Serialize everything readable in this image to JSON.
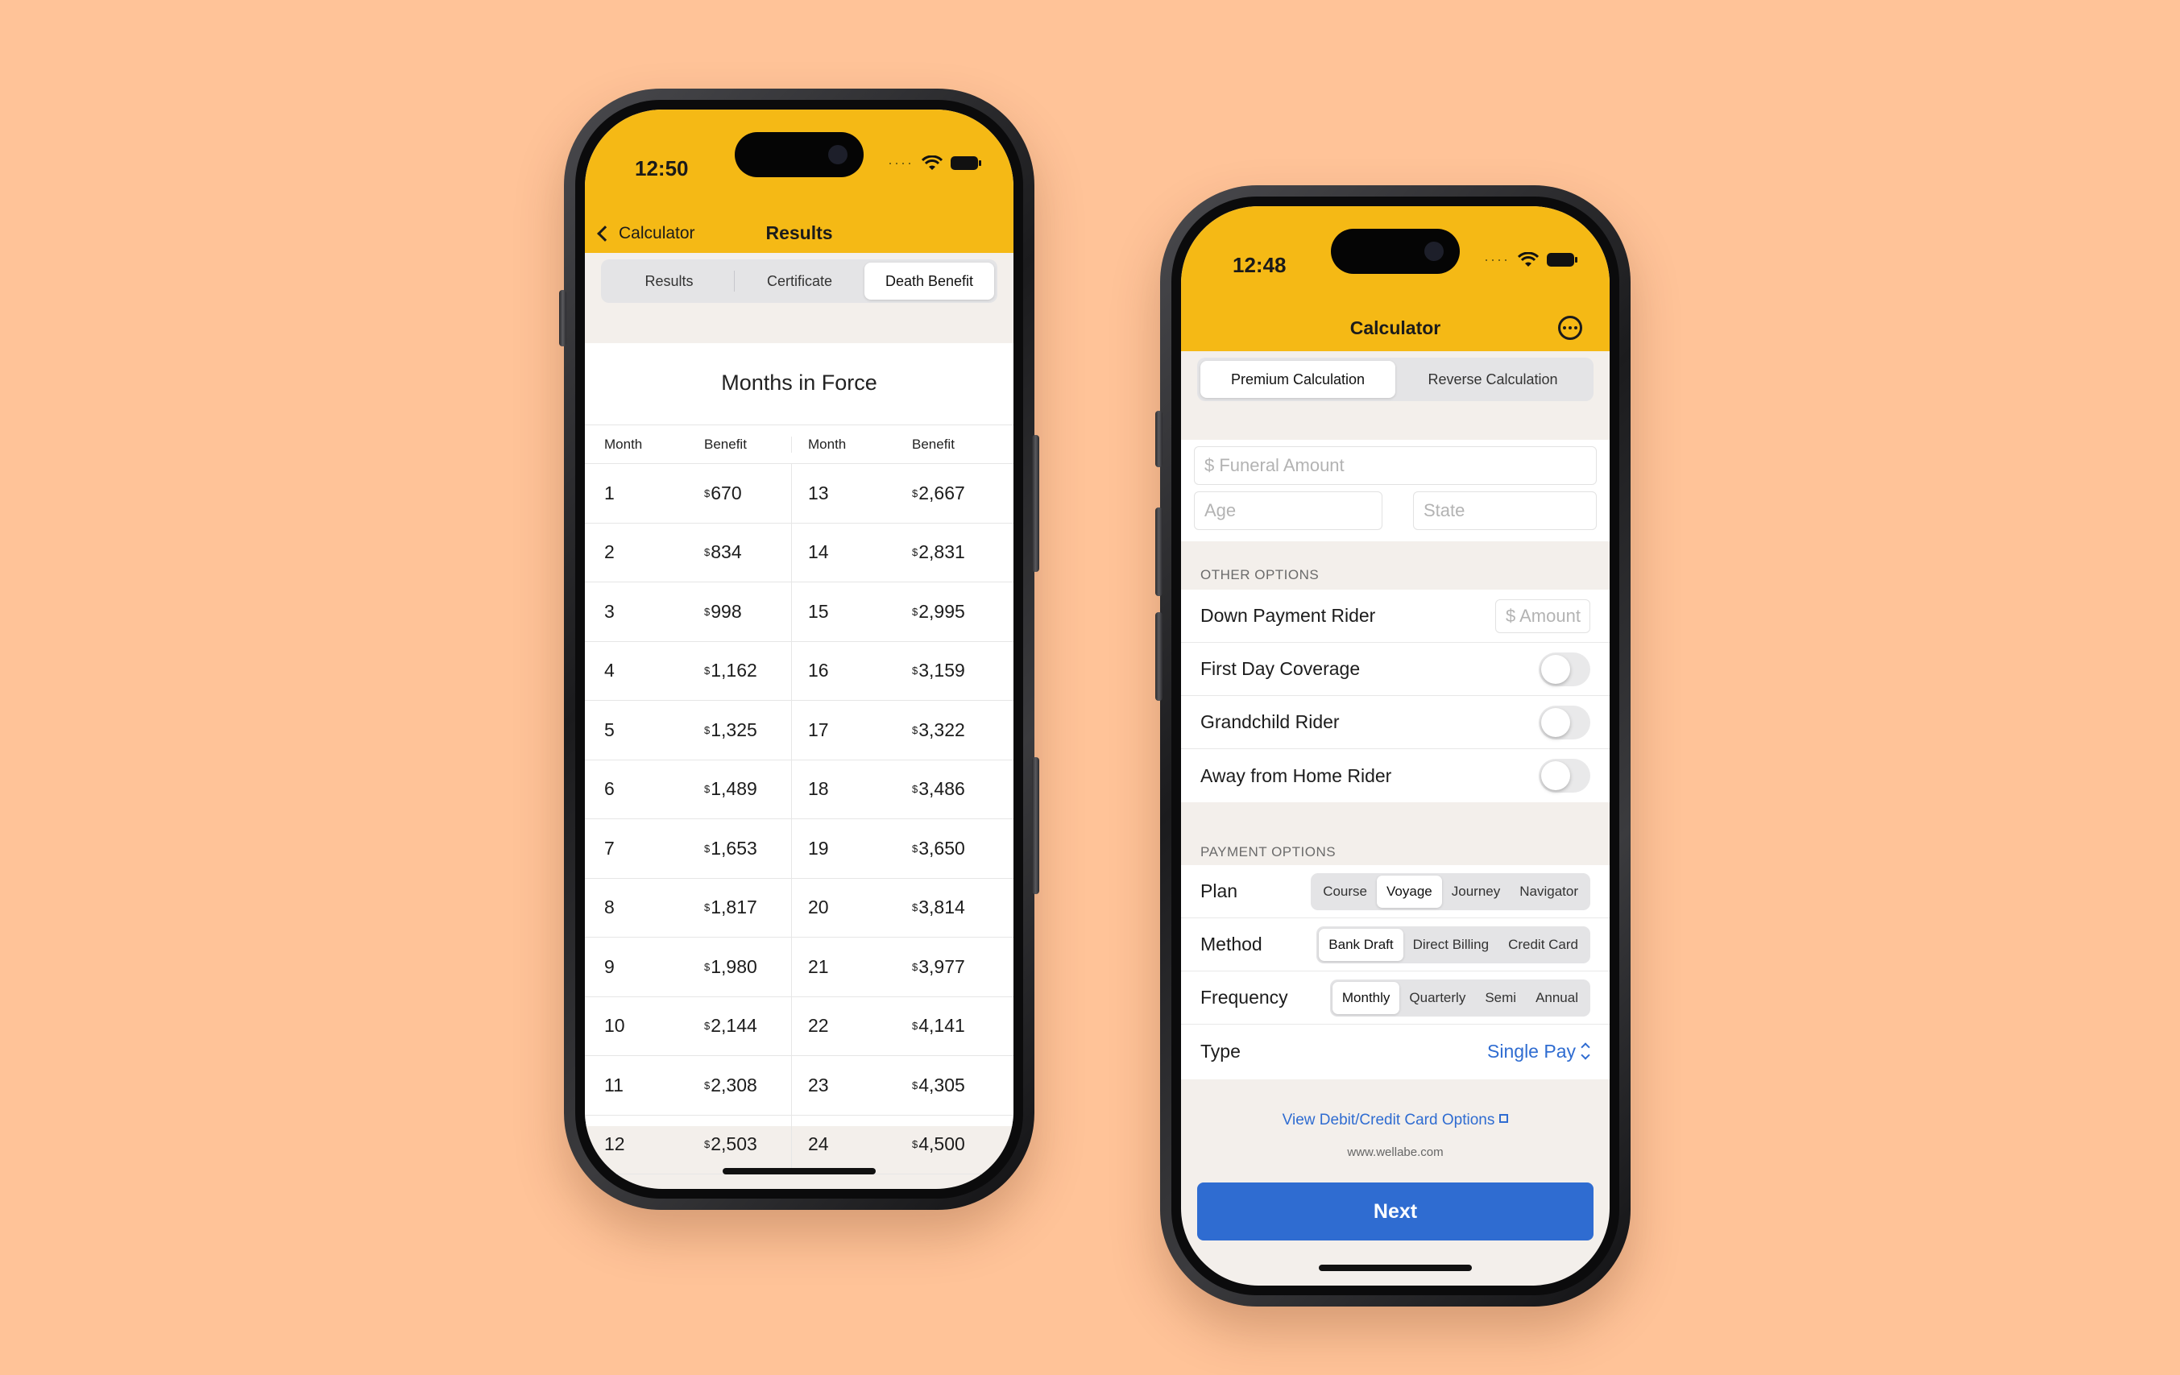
{
  "colors": {
    "background": "#ffc398",
    "header": "#f5b915",
    "accent": "#2f6cd1"
  },
  "phone1": {
    "time": "12:50",
    "back_label": "Calculator",
    "title": "Results",
    "tabs": [
      "Results",
      "Certificate",
      "Death Benefit"
    ],
    "active_tab": "Death Benefit",
    "table_title": "Months in Force",
    "headers": [
      "Month",
      "Benefit",
      "Month",
      "Benefit"
    ],
    "currency_symbol": "$",
    "rows": [
      {
        "m1": "1",
        "b1": "670",
        "m2": "13",
        "b2": "2,667"
      },
      {
        "m1": "2",
        "b1": "834",
        "m2": "14",
        "b2": "2,831"
      },
      {
        "m1": "3",
        "b1": "998",
        "m2": "15",
        "b2": "2,995"
      },
      {
        "m1": "4",
        "b1": "1,162",
        "m2": "16",
        "b2": "3,159"
      },
      {
        "m1": "5",
        "b1": "1,325",
        "m2": "17",
        "b2": "3,322"
      },
      {
        "m1": "6",
        "b1": "1,489",
        "m2": "18",
        "b2": "3,486"
      },
      {
        "m1": "7",
        "b1": "1,653",
        "m2": "19",
        "b2": "3,650"
      },
      {
        "m1": "8",
        "b1": "1,817",
        "m2": "20",
        "b2": "3,814"
      },
      {
        "m1": "9",
        "b1": "1,980",
        "m2": "21",
        "b2": "3,977"
      },
      {
        "m1": "10",
        "b1": "2,144",
        "m2": "22",
        "b2": "4,141"
      },
      {
        "m1": "11",
        "b1": "2,308",
        "m2": "23",
        "b2": "4,305"
      },
      {
        "m1": "12",
        "b1": "2,503",
        "m2": "24",
        "b2": "4,500"
      }
    ]
  },
  "phone2": {
    "time": "12:48",
    "title": "Calculator",
    "tabs": [
      "Premium Calculation",
      "Reverse Calculation"
    ],
    "active_tab": "Premium Calculation",
    "funeral_placeholder": "$  Funeral Amount",
    "age_placeholder": "Age",
    "state_placeholder": "State",
    "other_options_label": "OTHER OPTIONS",
    "down_payment_label": "Down Payment Rider",
    "amount_placeholder": "$  Amount",
    "first_day_label": "First Day Coverage",
    "grandchild_label": "Grandchild Rider",
    "away_label": "Away from Home Rider",
    "payment_options_label": "PAYMENT OPTIONS",
    "plan_label": "Plan",
    "plan_options": [
      "Course",
      "Voyage",
      "Journey",
      "Navigator"
    ],
    "plan_selected": "Voyage",
    "method_label": "Method",
    "method_options": [
      "Bank Draft",
      "Direct Billing",
      "Credit Card"
    ],
    "method_selected": "Bank Draft",
    "frequency_label": "Frequency",
    "frequency_options": [
      "Monthly",
      "Quarterly",
      "Semi",
      "Annual"
    ],
    "frequency_selected": "Monthly",
    "type_label": "Type",
    "type_value": "Single Pay",
    "card_link": "View Debit/Credit Card Options",
    "url": "www.wellabe.com",
    "next_label": "Next"
  }
}
